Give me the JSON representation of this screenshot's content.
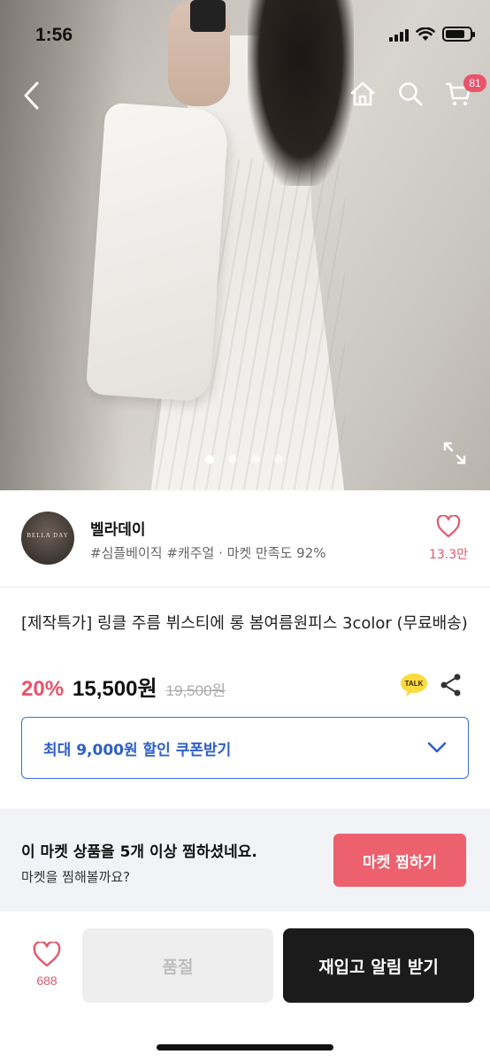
{
  "status_bar": {
    "time": "1:56"
  },
  "nav": {
    "cart_count": "81"
  },
  "carousel": {
    "total": 4,
    "active_index": 0
  },
  "seller": {
    "name": "벨라데이",
    "avatar_text": "BELLA DAY",
    "tags": "#심플베이직 #캐주얼 · 마켓 만족도 92%",
    "likes": "13.3만"
  },
  "product": {
    "title": "[제작특가]  링클 주름 뷔스티에 롱 봄여름원피스 3color (무료배송)",
    "discount": "20%",
    "price": "15,500원",
    "original_price": "19,500원",
    "talk_label": "TALK"
  },
  "coupon": {
    "label": "최대 9,000원 할인 쿠폰받기"
  },
  "wish_banner": {
    "title": "이 마켓 상품을 5개 이상 찜하셨네요.",
    "subtitle": "마켓을 찜해볼까요?",
    "button": "마켓 찜하기"
  },
  "bottom_bar": {
    "like_count": "688",
    "soldout_label": "품절",
    "restock_label": "재입고 알림 받기"
  },
  "colors": {
    "accent_pink": "#e9546b",
    "coupon_blue": "#2e5ec9",
    "dark_button": "#1b1b1b"
  }
}
